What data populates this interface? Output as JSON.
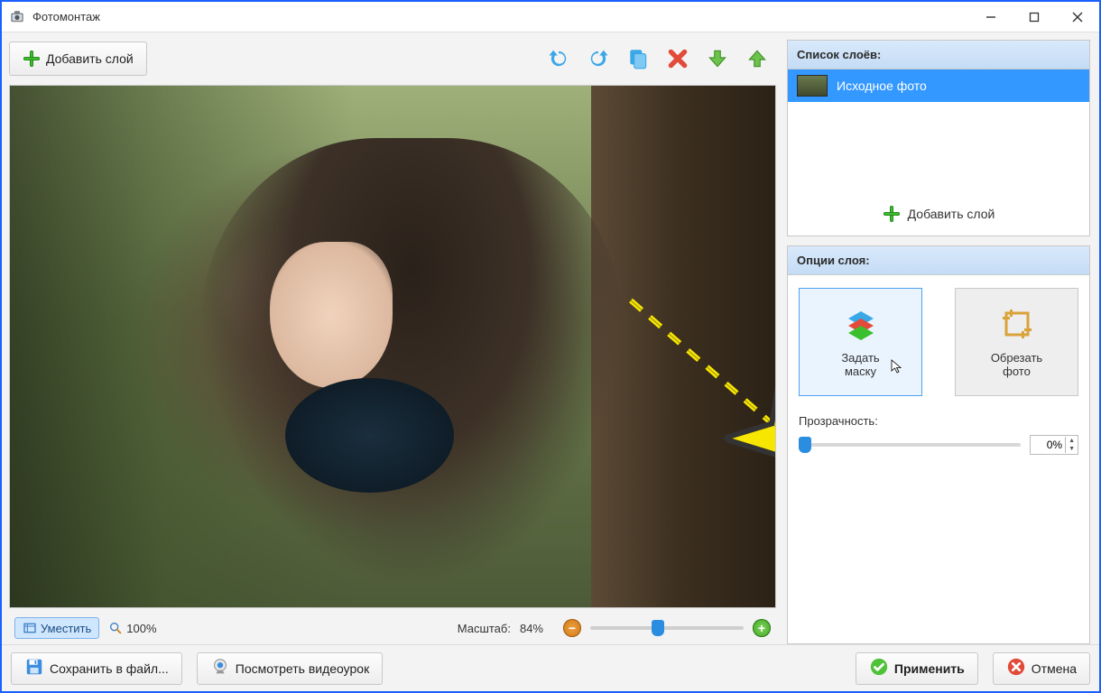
{
  "window": {
    "title": "Фотомонтаж"
  },
  "toolbar": {
    "add_layer": "Добавить слой"
  },
  "zoom": {
    "fit_label": "Уместить",
    "hundred": "100%",
    "scale_label": "Масштаб:",
    "scale_value": "84%"
  },
  "layers": {
    "header": "Список слоёв:",
    "items": [
      {
        "label": "Исходное фото"
      }
    ],
    "add_layer": "Добавить слой"
  },
  "options": {
    "header": "Опции слоя:",
    "set_mask": "Задать\nмаску",
    "crop_photo": "Обрезать\nфото",
    "opacity_label": "Прозрачность:",
    "opacity_value": "0%"
  },
  "footer": {
    "save": "Сохранить в файл...",
    "video": "Посмотреть видеоурок",
    "apply": "Применить",
    "cancel": "Отмена"
  }
}
